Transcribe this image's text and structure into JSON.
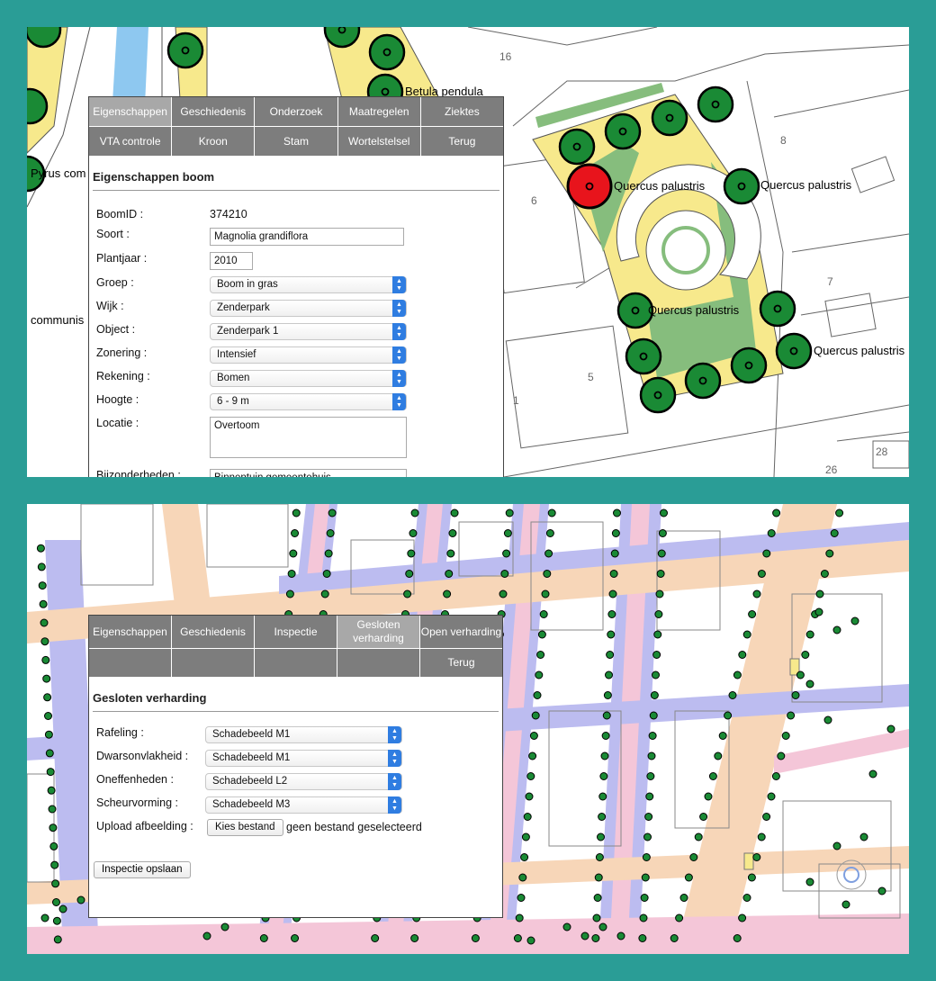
{
  "map_top": {
    "labels": {
      "betula": "Betula pendula",
      "pyrus": "Pyrus com",
      "communis": "communis",
      "quercus_selected": "Quercus palustris",
      "quercus_right": "Quercus palustris",
      "quercus_mid": "Quercus palustris",
      "quercus_bottom": "Quercus palustris"
    },
    "parcel_numbers": [
      "16",
      "8",
      "6",
      "7",
      "5",
      "1",
      "28",
      "26"
    ],
    "selected_tree_color": "#e8141c",
    "tree_color": "#1a8a35"
  },
  "tree_dialog": {
    "tabs_row1": [
      "Eigenschappen",
      "Geschiedenis",
      "Onderzoek",
      "Maatregelen",
      "Ziektes"
    ],
    "tabs_row2": [
      "VTA controle",
      "Kroon",
      "Stam",
      "Wortelstelsel",
      "Terug"
    ],
    "active_tab": "Eigenschappen",
    "title": "Eigenschappen boom",
    "fields": {
      "boomid_label": "BoomID :",
      "boomid_value": "374210",
      "soort_label": "Soort :",
      "soort_value": "Magnolia grandiflora",
      "plantjaar_label": "Plantjaar :",
      "plantjaar_value": "2010",
      "groep_label": "Groep :",
      "groep_value": "Boom in gras",
      "wijk_label": "Wijk :",
      "wijk_value": "Zenderpark",
      "object_label": "Object :",
      "object_value": "Zenderpark 1",
      "zonering_label": "Zonering :",
      "zonering_value": "Intensief",
      "rekening_label": "Rekening :",
      "rekening_value": "Bomen",
      "hoogte_label": "Hoogte :",
      "hoogte_value": "6 - 9 m",
      "locatie_label": "Locatie :",
      "locatie_value": "Overtoom",
      "bijzonderheden_label": "Bijzonderheden :",
      "bijzonderheden_value": "Binnentuin gemeentehuis"
    }
  },
  "inspection_dialog": {
    "tabs_row1": [
      "Eigenschappen",
      "Geschiedenis",
      "Inspectie",
      "Gesloten verharding",
      "Open verharding"
    ],
    "tabs_row2": [
      "",
      "",
      "",
      "",
      "Terug"
    ],
    "active_tab": "Gesloten verharding",
    "title": "Gesloten verharding",
    "fields": {
      "rafeling_label": "Rafeling :",
      "rafeling_value": "Schadebeeld M1",
      "dwarson_label": "Dwarsonvlakheid :",
      "dwarson_value": "Schadebeeld M1",
      "oneffen_label": "Oneffenheden :",
      "oneffen_value": "Schadebeeld L2",
      "scheur_label": "Scheurvorming :",
      "scheur_value": "Schadebeeld M3",
      "upload_label": "Upload afbeelding :",
      "choose_file": "Kies bestand",
      "no_file": "geen bestand geselecteerd",
      "save_button": "Inspectie opslaan"
    }
  },
  "colors": {
    "background": "#2a9d96",
    "tab": "#7d7d7d",
    "tab_active": "#a8a8a8",
    "select_arrow": "#2f7de1",
    "plaza_yellow": "#f7e98c",
    "grass_green": "#86bd7d",
    "water_blue": "#8ec8f0",
    "street_pink": "#f4c6d8",
    "street_purple": "#bcbcf0",
    "street_orange": "#f7d6b8"
  }
}
